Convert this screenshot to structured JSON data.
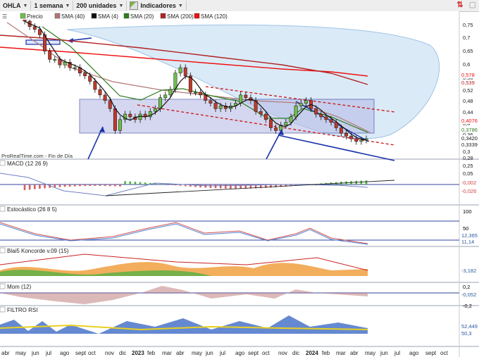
{
  "toolbar": {
    "symbol": "OHLA",
    "period": "1 semana",
    "units": "200 unidades",
    "indicators": "Indicadores"
  },
  "legend": {
    "price": "Precio",
    "sma1": "SMA (40)",
    "sma2": "SMA (4)",
    "sma3": "SMA (20)",
    "sma4": "SMA (200)",
    "sma5": "SMA (120)"
  },
  "source_note": "ProRealTime.com - Fin de Día",
  "colors": {
    "sma40": "#b07878",
    "sma4": "#111111",
    "sma20": "#2e7d1f",
    "sma200": "#b22222",
    "sma120": "#ee1111",
    "box_fill": "#b8bde6",
    "cloud_fill": "#cfe3f5",
    "arrow": "#1a33aa"
  },
  "chart_data": {
    "type": "candlestick",
    "y_axis_ticks": [
      "0,75",
      "0,7",
      "0,65",
      "0,6",
      "0,56",
      "0,52",
      "0,48",
      "0,44",
      "0,4",
      "0,36",
      "0,32",
      "0,3",
      "0,28",
      "0,25",
      "0,05"
    ],
    "price_tags": [
      {
        "label": "0,578",
        "color": "#ee1111"
      },
      {
        "label": "0,539",
        "color": "#b22222"
      },
      {
        "label": "0,4076",
        "color": "#ee1111"
      },
      {
        "label": "0,3786",
        "color": "#2e7d1f"
      },
      {
        "label": "0,3420",
        "color": "#111111"
      },
      {
        "label": "0,3339",
        "color": "#ffffff"
      }
    ],
    "x_axis_ticks": [
      "abr",
      "may",
      "jun",
      "jul",
      "ago",
      "sept",
      "oct",
      "nov",
      "dic",
      "2023",
      "feb",
      "mar",
      "abr",
      "may",
      "jun",
      "jul",
      "ago",
      "sept",
      "oct",
      "nov",
      "dic",
      "2024",
      "feb",
      "mar",
      "abr",
      "may",
      "jun",
      "jul",
      "ago",
      "sept",
      "oct"
    ],
    "price_series": [
      0.77,
      0.75,
      0.74,
      0.72,
      0.66,
      0.63,
      0.63,
      0.61,
      0.62,
      0.6,
      0.6,
      0.58,
      0.57,
      0.55,
      0.52,
      0.5,
      0.48,
      0.45,
      0.37,
      0.41,
      0.43,
      0.42,
      0.41,
      0.43,
      0.42,
      0.44,
      0.45,
      0.49,
      0.5,
      0.52,
      0.58,
      0.6,
      0.57,
      0.51,
      0.51,
      0.5,
      0.48,
      0.47,
      0.45,
      0.46,
      0.45,
      0.46,
      0.47,
      0.5,
      0.49,
      0.48,
      0.44,
      0.43,
      0.41,
      0.38,
      0.37,
      0.39,
      0.4,
      0.42,
      0.46,
      0.47,
      0.48,
      0.45,
      0.43,
      0.42,
      0.41,
      0.4,
      0.38,
      0.36,
      0.35,
      0.34,
      0.33,
      0.335,
      0.34
    ],
    "panels": [
      {
        "name": "MACD (12 26 9)",
        "tags": [
          "-0,002",
          "-0,026"
        ]
      },
      {
        "name": "Estocástico (26 8 5)",
        "ticks": [
          "100",
          "50"
        ],
        "tags": [
          "12,365",
          "11,14"
        ]
      },
      {
        "name": "Blai5 Koncorde v.09 (15)",
        "tags": [
          "-3,182"
        ]
      },
      {
        "name": "Mom (12)",
        "ticks": [
          "0,2",
          "-0,2"
        ],
        "tags": [
          "-0,052"
        ]
      },
      {
        "name": "FILTRO RSI",
        "tags": [
          "52,449",
          "50,3"
        ]
      }
    ]
  }
}
